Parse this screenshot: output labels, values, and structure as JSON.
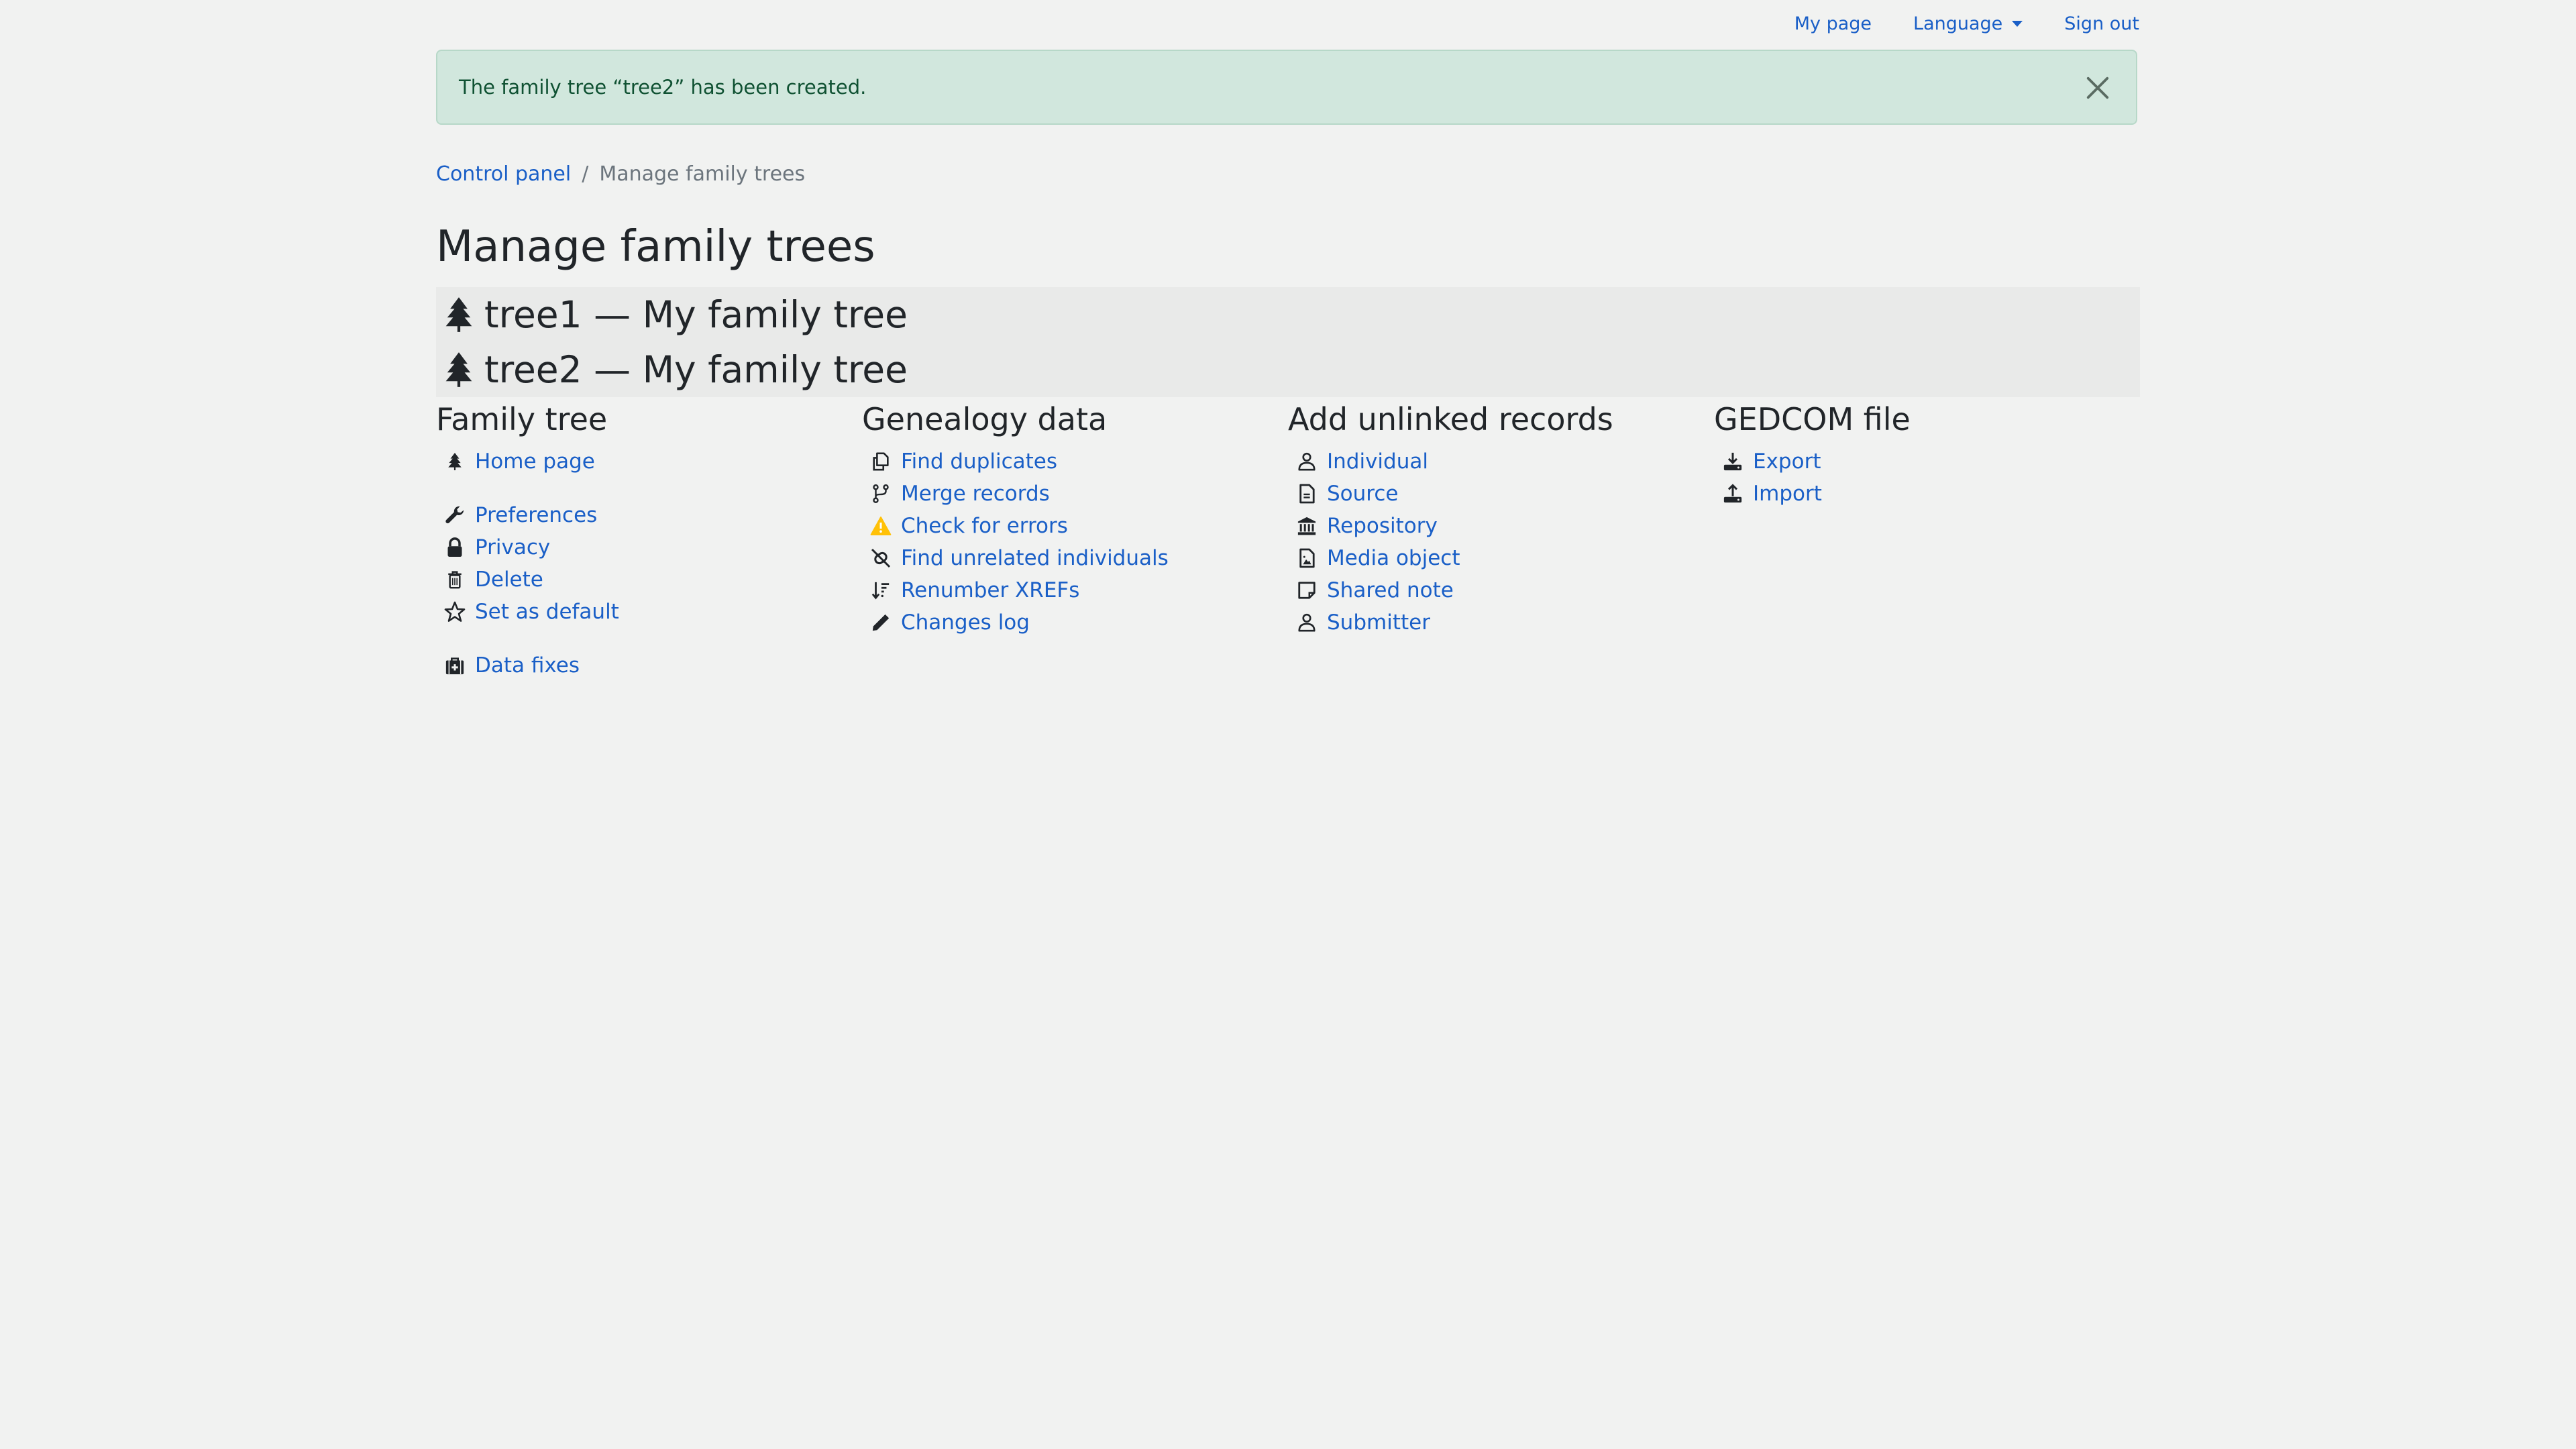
{
  "topnav": {
    "my_page": "My page",
    "language": "Language",
    "sign_out": "Sign out"
  },
  "alert": {
    "message": "The family tree “tree2” has been created.",
    "close_icon": "close-icon"
  },
  "breadcrumb": {
    "items": [
      "Control panel",
      "Manage family trees"
    ],
    "separator": "/"
  },
  "page_title": "Manage family trees",
  "trees": [
    {
      "label": "tree1 — My family tree",
      "icon": "tree-icon"
    },
    {
      "label": "tree2 — My family tree",
      "icon": "tree-icon"
    }
  ],
  "sections": {
    "family_tree": {
      "title": "Family tree",
      "items": [
        {
          "label": "Home page",
          "icon": "tree-icon"
        },
        {
          "label": "Preferences",
          "icon": "wrench-icon"
        },
        {
          "label": "Privacy",
          "icon": "lock-icon"
        },
        {
          "label": "Delete",
          "icon": "trash-icon"
        },
        {
          "label": "Set as default",
          "icon": "star-icon"
        },
        {
          "label": "Data fixes",
          "icon": "medkit-icon"
        }
      ]
    },
    "genealogy_data": {
      "title": "Genealogy data",
      "items": [
        {
          "label": "Find duplicates",
          "icon": "copy-icon"
        },
        {
          "label": "Merge records",
          "icon": "code-branch-icon"
        },
        {
          "label": "Check for errors",
          "icon": "warning-icon"
        },
        {
          "label": "Find unrelated individuals",
          "icon": "unlink-icon"
        },
        {
          "label": "Renumber XREFs",
          "icon": "sort-down-icon"
        },
        {
          "label": "Changes log",
          "icon": "pencil-icon"
        }
      ]
    },
    "add_unlinked": {
      "title": "Add unlinked records",
      "items": [
        {
          "label": "Individual",
          "icon": "user-icon"
        },
        {
          "label": "Source",
          "icon": "file-icon"
        },
        {
          "label": "Repository",
          "icon": "bank-icon"
        },
        {
          "label": "Media object",
          "icon": "file-image-icon"
        },
        {
          "label": "Shared note",
          "icon": "sticky-note-icon"
        },
        {
          "label": "Submitter",
          "icon": "user-icon"
        }
      ]
    },
    "gedcom": {
      "title": "GEDCOM file",
      "items": [
        {
          "label": "Export",
          "icon": "download-icon"
        },
        {
          "label": "Import",
          "icon": "upload-icon"
        }
      ]
    }
  },
  "colors": {
    "link": "#1a5fc7",
    "alert_bg": "#d1e7dd",
    "alert_text": "#0f5132",
    "warning": "#ffc107"
  }
}
